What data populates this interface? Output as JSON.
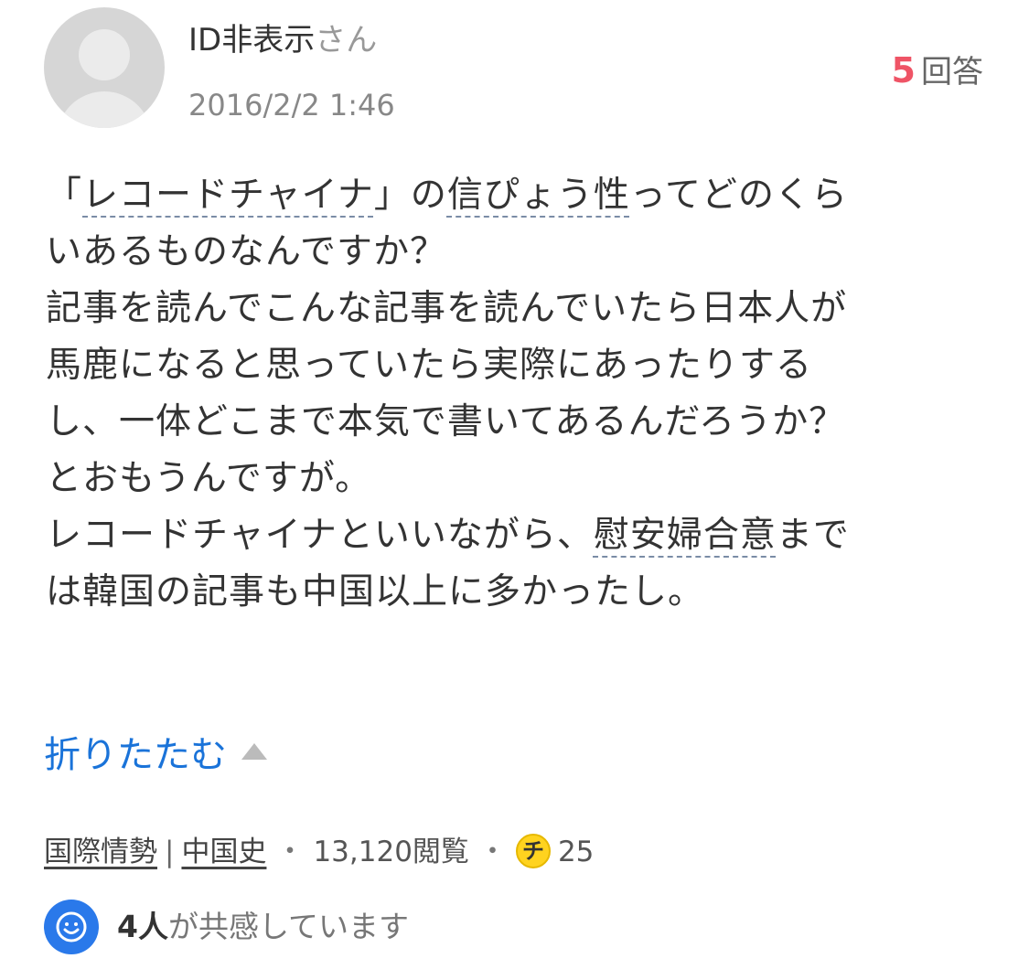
{
  "user": {
    "name": "ID非表示",
    "suffix": "さん",
    "date": "2016/2/2 1:46"
  },
  "answers": {
    "count": "5",
    "label": "回答"
  },
  "question": {
    "line1": {
      "open": "「",
      "kw1": "レコードチャイナ",
      "close": "」の",
      "kw2": "信ぴょう性",
      "rest": "ってどのくら"
    },
    "line2": "いあるものなんですか？",
    "line3": "記事を読んでこんな記事を読んでいたら日本人が",
    "line4": "馬鹿になると思っていたら実際にあったりする",
    "line5": "し、一体どこまで本気で書いてあるんだろうか？",
    "line6": "とおもうんですが。",
    "line7": {
      "pre": "レコードチャイナといいながら、",
      "kw": "慰安婦合意",
      "post": "まで"
    },
    "line8": "は韓国の記事も中国以上に多かったし。"
  },
  "collapse_label": "折りたたむ",
  "meta": {
    "category1": "国際情勢",
    "separator": "|",
    "category2": "中国史",
    "dot": "・",
    "views": "13,120閲覧",
    "coin_glyph": "チ",
    "coins": "25"
  },
  "empathy": {
    "count": "4人",
    "text": "が共感しています"
  },
  "icons": {
    "avatar": "default-avatar-icon",
    "collapse": "triangle-up-icon",
    "coin": "chiebukuro-coin-icon",
    "empathy": "smile-icon"
  },
  "colors": {
    "accent_red": "#ef5466",
    "link_blue": "#1a73d9",
    "coin_yellow": "#ffd31f",
    "empathy_blue": "#2a79ea"
  }
}
